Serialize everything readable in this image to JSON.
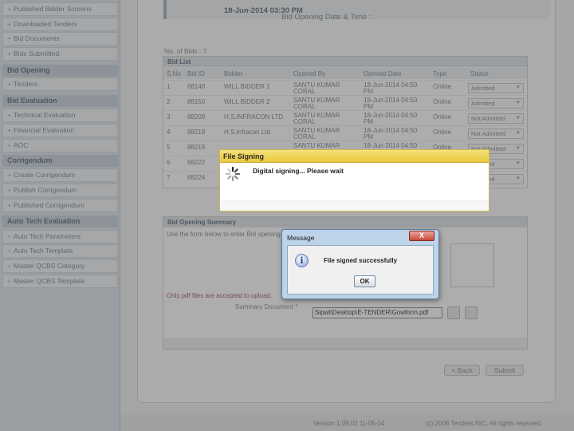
{
  "sidebar": {
    "items_top": [
      "Published Bidder Screens",
      "Downloaded Tenders",
      "Bid Documents",
      "Bids Submitted"
    ],
    "section_bid_opening": "Bid Opening",
    "items_bid_opening": [
      "Tenders"
    ],
    "section_bid_evaluation": "Bid Evaluation",
    "items_bid_evaluation": [
      "Technical Evaluation",
      "Financial Evaluation",
      "AOC"
    ],
    "section_corrigendum": "Corrigendum",
    "items_corrigendum": [
      "Create Corrigendum",
      "Publish Corrigendum",
      "Published Corrigendum"
    ],
    "section_auto_tech": "Auto Tech Evaluation",
    "items_auto_tech": [
      "Auto Tech Parameters",
      "Auto Tech Template",
      "Master QCBS Category",
      "Master QCBS Template"
    ]
  },
  "header": {
    "bid_opening_label": "Bid Opening Date & Time :",
    "bid_opening_value": "18-Jun-2014 03:30 PM"
  },
  "bid_list": {
    "count_label": "No. of Bids : 7",
    "title": "Bid List",
    "columns": [
      "S.No",
      "Bid ID",
      "Bidder",
      "Opened By",
      "Opened Date",
      "Type",
      "Status"
    ],
    "rows": [
      {
        "sno": "1",
        "bid_id": "88148",
        "bidder": "WILL BIDDER 1",
        "opened_by": "SANTU KUMAR CORAL",
        "opened_date": "18-Jun-2014 04:50 PM",
        "type": "Online",
        "status": "Admitted"
      },
      {
        "sno": "2",
        "bid_id": "88150",
        "bidder": "WILL BIDDER 2",
        "opened_by": "SANTU KUMAR CORAL",
        "opened_date": "18-Jun-2014 04:50 PM",
        "type": "Online",
        "status": "Admitted"
      },
      {
        "sno": "3",
        "bid_id": "88209",
        "bidder": "H.S.INFRACON LTD",
        "opened_by": "SANTU KUMAR CORAL",
        "opened_date": "18-Jun-2014 04:50 PM",
        "type": "Online",
        "status": "Not Admitted"
      },
      {
        "sno": "4",
        "bid_id": "88218",
        "bidder": "H.S.Infracon Ltd",
        "opened_by": "SANTU KUMAR CORAL",
        "opened_date": "18-Jun-2014 04:50 PM",
        "type": "Online",
        "status": "Not Admitted"
      },
      {
        "sno": "5",
        "bid_id": "88219",
        "bidder": "",
        "opened_by": "SANTU KUMAR",
        "opened_date": "18-Jun-2014 04:50",
        "type": "Online",
        "status": "Not Admitted"
      },
      {
        "sno": "6",
        "bid_id": "88222",
        "bidder": "",
        "opened_by": "",
        "opened_date": "",
        "type": "",
        "status": "Admitted"
      },
      {
        "sno": "7",
        "bid_id": "88224",
        "bidder": "",
        "opened_by": "",
        "opened_date": "",
        "type": "",
        "status": "Admitted"
      }
    ]
  },
  "summary": {
    "title": "Bid Opening Summary",
    "hint": "Use the form below to enter Bid opening",
    "pdf_note": "Only pdf files are accepted to upload.",
    "doc_label": "Summary Document *",
    "file_path": "Sipwt\\Desktop\\E-TENDER\\Gowform.pdf"
  },
  "buttons": {
    "back": "< Back",
    "submit": "Submit"
  },
  "footer": {
    "version": "Version 1.09.02 11-05-14",
    "copyright": "(c) 2008 Tenders NIC, All rights reserved."
  },
  "file_signing": {
    "title": "File Signing",
    "message": "Digital signing... Please wait"
  },
  "message_dialog": {
    "title": "Message",
    "text": "File signed successfully",
    "ok_label": "OK",
    "close_label": "X",
    "icon": "info-icon"
  }
}
